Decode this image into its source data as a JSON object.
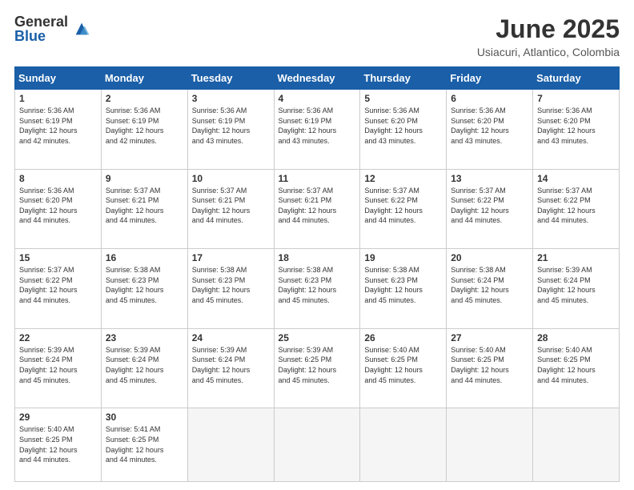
{
  "logo": {
    "general": "General",
    "blue": "Blue"
  },
  "title": "June 2025",
  "location": "Usiacuri, Atlantico, Colombia",
  "days_of_week": [
    "Sunday",
    "Monday",
    "Tuesday",
    "Wednesday",
    "Thursday",
    "Friday",
    "Saturday"
  ],
  "weeks": [
    [
      {
        "num": "1",
        "info": "Sunrise: 5:36 AM\nSunset: 6:19 PM\nDaylight: 12 hours\nand 42 minutes."
      },
      {
        "num": "2",
        "info": "Sunrise: 5:36 AM\nSunset: 6:19 PM\nDaylight: 12 hours\nand 42 minutes."
      },
      {
        "num": "3",
        "info": "Sunrise: 5:36 AM\nSunset: 6:19 PM\nDaylight: 12 hours\nand 43 minutes."
      },
      {
        "num": "4",
        "info": "Sunrise: 5:36 AM\nSunset: 6:19 PM\nDaylight: 12 hours\nand 43 minutes."
      },
      {
        "num": "5",
        "info": "Sunrise: 5:36 AM\nSunset: 6:20 PM\nDaylight: 12 hours\nand 43 minutes."
      },
      {
        "num": "6",
        "info": "Sunrise: 5:36 AM\nSunset: 6:20 PM\nDaylight: 12 hours\nand 43 minutes."
      },
      {
        "num": "7",
        "info": "Sunrise: 5:36 AM\nSunset: 6:20 PM\nDaylight: 12 hours\nand 43 minutes."
      }
    ],
    [
      {
        "num": "8",
        "info": "Sunrise: 5:36 AM\nSunset: 6:20 PM\nDaylight: 12 hours\nand 44 minutes."
      },
      {
        "num": "9",
        "info": "Sunrise: 5:37 AM\nSunset: 6:21 PM\nDaylight: 12 hours\nand 44 minutes."
      },
      {
        "num": "10",
        "info": "Sunrise: 5:37 AM\nSunset: 6:21 PM\nDaylight: 12 hours\nand 44 minutes."
      },
      {
        "num": "11",
        "info": "Sunrise: 5:37 AM\nSunset: 6:21 PM\nDaylight: 12 hours\nand 44 minutes."
      },
      {
        "num": "12",
        "info": "Sunrise: 5:37 AM\nSunset: 6:22 PM\nDaylight: 12 hours\nand 44 minutes."
      },
      {
        "num": "13",
        "info": "Sunrise: 5:37 AM\nSunset: 6:22 PM\nDaylight: 12 hours\nand 44 minutes."
      },
      {
        "num": "14",
        "info": "Sunrise: 5:37 AM\nSunset: 6:22 PM\nDaylight: 12 hours\nand 44 minutes."
      }
    ],
    [
      {
        "num": "15",
        "info": "Sunrise: 5:37 AM\nSunset: 6:22 PM\nDaylight: 12 hours\nand 44 minutes."
      },
      {
        "num": "16",
        "info": "Sunrise: 5:38 AM\nSunset: 6:23 PM\nDaylight: 12 hours\nand 45 minutes."
      },
      {
        "num": "17",
        "info": "Sunrise: 5:38 AM\nSunset: 6:23 PM\nDaylight: 12 hours\nand 45 minutes."
      },
      {
        "num": "18",
        "info": "Sunrise: 5:38 AM\nSunset: 6:23 PM\nDaylight: 12 hours\nand 45 minutes."
      },
      {
        "num": "19",
        "info": "Sunrise: 5:38 AM\nSunset: 6:23 PM\nDaylight: 12 hours\nand 45 minutes."
      },
      {
        "num": "20",
        "info": "Sunrise: 5:38 AM\nSunset: 6:24 PM\nDaylight: 12 hours\nand 45 minutes."
      },
      {
        "num": "21",
        "info": "Sunrise: 5:39 AM\nSunset: 6:24 PM\nDaylight: 12 hours\nand 45 minutes."
      }
    ],
    [
      {
        "num": "22",
        "info": "Sunrise: 5:39 AM\nSunset: 6:24 PM\nDaylight: 12 hours\nand 45 minutes."
      },
      {
        "num": "23",
        "info": "Sunrise: 5:39 AM\nSunset: 6:24 PM\nDaylight: 12 hours\nand 45 minutes."
      },
      {
        "num": "24",
        "info": "Sunrise: 5:39 AM\nSunset: 6:24 PM\nDaylight: 12 hours\nand 45 minutes."
      },
      {
        "num": "25",
        "info": "Sunrise: 5:39 AM\nSunset: 6:25 PM\nDaylight: 12 hours\nand 45 minutes."
      },
      {
        "num": "26",
        "info": "Sunrise: 5:40 AM\nSunset: 6:25 PM\nDaylight: 12 hours\nand 45 minutes."
      },
      {
        "num": "27",
        "info": "Sunrise: 5:40 AM\nSunset: 6:25 PM\nDaylight: 12 hours\nand 44 minutes."
      },
      {
        "num": "28",
        "info": "Sunrise: 5:40 AM\nSunset: 6:25 PM\nDaylight: 12 hours\nand 44 minutes."
      }
    ],
    [
      {
        "num": "29",
        "info": "Sunrise: 5:40 AM\nSunset: 6:25 PM\nDaylight: 12 hours\nand 44 minutes."
      },
      {
        "num": "30",
        "info": "Sunrise: 5:41 AM\nSunset: 6:25 PM\nDaylight: 12 hours\nand 44 minutes."
      },
      {
        "num": "",
        "info": ""
      },
      {
        "num": "",
        "info": ""
      },
      {
        "num": "",
        "info": ""
      },
      {
        "num": "",
        "info": ""
      },
      {
        "num": "",
        "info": ""
      }
    ]
  ]
}
